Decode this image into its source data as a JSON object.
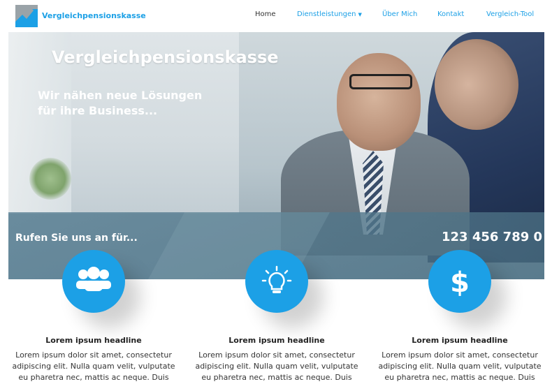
{
  "header": {
    "brand": "Vergleichpensionskasse",
    "logo_icon": "chart-trend-icon",
    "nav": [
      {
        "label": "Home",
        "active": true
      },
      {
        "label": "Dienstleistungen",
        "dropdown": true
      },
      {
        "label": "Über Mich"
      },
      {
        "label": "Kontakt"
      },
      {
        "label": "Vergleich-Tool"
      }
    ],
    "accent_color": "#1ca0e6"
  },
  "hero": {
    "title": "Vergleichpensionskasse",
    "subtitle": "Wir nähen neue Lösungen für ihre Business...",
    "call_text": "Rufen Sie uns an für...",
    "phone": "123 456 789 0"
  },
  "features": [
    {
      "icon": "users-icon",
      "headline": "Lorem ipsum headline",
      "text": "Lorem ipsum dolor sit amet, consectetur adipiscing elit. Nulla quam velit, vulputate eu pharetra nec, mattis ac neque. Duis"
    },
    {
      "icon": "lightbulb-icon",
      "headline": "Lorem ipsum headline",
      "text": "Lorem ipsum dolor sit amet, consectetur adipiscing elit. Nulla quam velit, vulputate eu pharetra nec, mattis ac neque. Duis"
    },
    {
      "icon": "dollar-icon",
      "headline": "Lorem ipsum headline",
      "text": "Lorem ipsum dolor sit amet, consectetur adipiscing elit. Nulla quam velit, vulputate eu pharetra nec, mattis ac neque. Duis"
    }
  ]
}
